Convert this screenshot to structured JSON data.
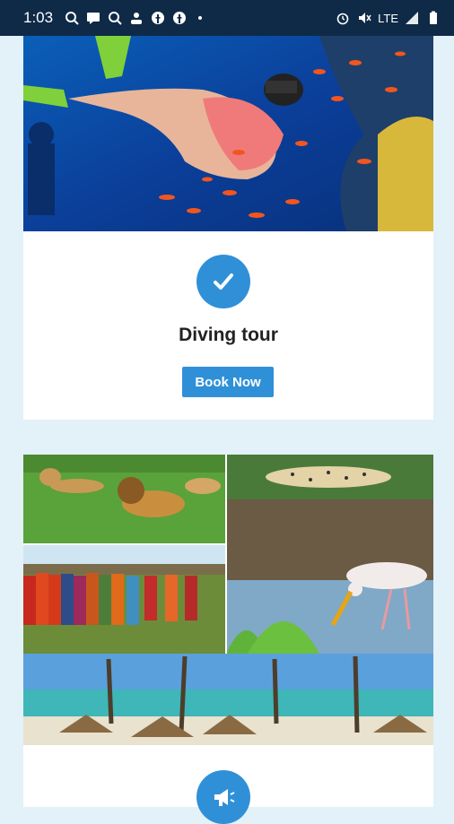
{
  "status_bar": {
    "time": "1:03",
    "network": "LTE",
    "notification_icons": [
      "google-search-icon",
      "message-icon",
      "google-search-icon",
      "person-icon",
      "facebook-icon",
      "facebook-icon"
    ]
  },
  "tours": [
    {
      "title": "Diving tour",
      "button_label": "Book Now",
      "badge_icon": "checkmark-icon"
    },
    {
      "badge_icon": "megaphone-icon"
    }
  ],
  "colors": {
    "accent": "#2f90d8",
    "status_bar": "#0f2a47",
    "background": "#e3f1f8"
  }
}
